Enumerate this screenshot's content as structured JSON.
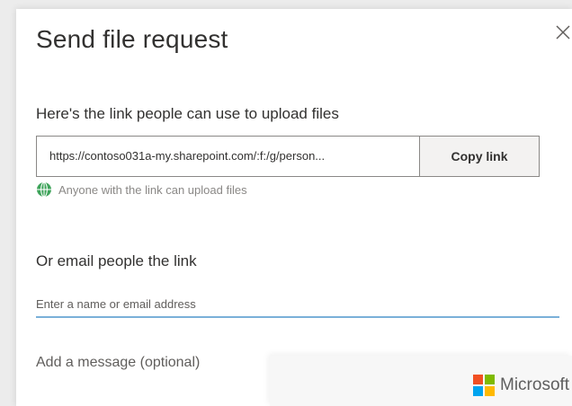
{
  "dialog": {
    "title": "Send file request",
    "close_icon": "close-icon"
  },
  "link_section": {
    "heading": "Here's the link people can use to upload files",
    "link_value": "https://contoso031a-my.sharepoint.com/:f:/g/person...",
    "copy_button_label": "Copy link",
    "permission_icon": "globe-icon",
    "permission_text": "Anyone with the link can upload files"
  },
  "email_section": {
    "heading": "Or email people the link",
    "email_placeholder": "Enter a name or email address",
    "message_placeholder": "Add a message (optional)"
  },
  "footer": {
    "brand_text": "Microsoft",
    "logo_icon": "microsoft-logo"
  },
  "colors": {
    "input_focus_underline": "#7ab0d9",
    "globe_green": "#3fa45b",
    "button_bg": "#f3f2f1",
    "ms_red": "#f25022",
    "ms_green": "#7fba00",
    "ms_blue": "#00a4ef",
    "ms_yellow": "#ffb900"
  }
}
